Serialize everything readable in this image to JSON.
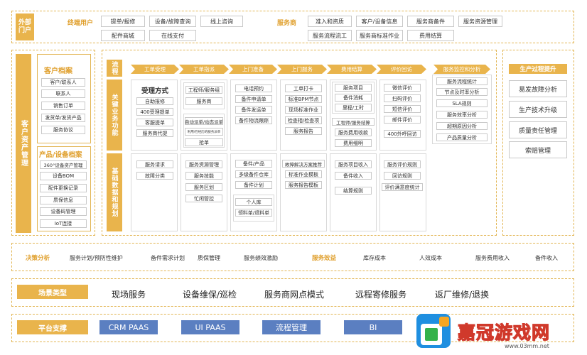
{
  "top": {
    "portal_label": "外部门户",
    "terminal_user": "终端用户",
    "terminal_items": [
      "提单/报修",
      "设备/故障查询",
      "线上咨询",
      "配件商城",
      "在线支付"
    ],
    "provider": "服务商",
    "provider_items": [
      "准入和资质",
      "客户/设备信息",
      "服务商备件",
      "服务资源管理",
      "服务流程流工",
      "服务商标准作业",
      "费用结算"
    ]
  },
  "left": {
    "side_label": "客户资产管理",
    "customer_title": "客户档案",
    "customer_items": [
      "客户/联系人",
      "联系人",
      "销售订单",
      "发货单/发货产品",
      "服务协议"
    ],
    "device_title": "产品/设备档案",
    "device_items": [
      "360°设备资产管理",
      "设备BOM",
      "配件更换记录",
      "质保信息",
      "设备码管理",
      "IoT连接"
    ]
  },
  "mid": {
    "flow_label": "流程",
    "key_label": "关键业务功能",
    "base_label": "基础数据和规划",
    "stages": [
      "工单受理",
      "工单指派",
      "上门准备",
      "上门服务",
      "费用结算",
      "评价回访",
      "服务监控和分析"
    ],
    "col1": {
      "title": "受理方式",
      "items": [
        "自助报修",
        "400受理提单",
        "客服提单",
        "服务商代提"
      ],
      "base": [
        "服务请求",
        "故障分类"
      ]
    },
    "col2": {
      "items_a": [
        "工程师/服务组",
        "服务商"
      ],
      "items_b": [
        "自动派单/动态派单",
        "利用/在经历的服务派单",
        "抢单"
      ],
      "base": [
        "服务资源管理",
        "服务技能",
        "服务区划",
        "忙闲管控"
      ]
    },
    "col3": {
      "items": [
        "电话预约",
        "备件申请单",
        "备件发运单",
        "备件物流跟踪"
      ],
      "base_a": [
        "备件/产品",
        "多级备件仓库",
        "备件计划"
      ],
      "base_b": [
        "个人库",
        "领料单/退料单"
      ]
    },
    "col4": {
      "items": [
        "工单打卡",
        "标准BPM节点",
        "现场标准作业",
        "检查相/检查项",
        "服务报告"
      ],
      "base": [
        "故障解决方案推荐",
        "标准作业模板",
        "服务报告模板"
      ]
    },
    "col5": {
      "items_a": [
        "服务项目",
        "备件消耗",
        "里程/工时"
      ],
      "items_b": [
        "工程师/服务结算",
        "服务费用收款",
        "费用细明"
      ],
      "base": [
        "服务项目收入",
        "备件收入",
        "结算规则"
      ]
    },
    "col6": {
      "items": [
        "微信评价",
        "扫码评价",
        "短信评价",
        "邮件评价",
        "400外呼回访"
      ],
      "base": [
        "服务评价规则",
        "回访规则",
        "评价满意度统计"
      ]
    },
    "col7": {
      "items": [
        "服务流程统计",
        "节点及时率分析",
        "SLA规则",
        "服务效率分析",
        "超期原因分析",
        "产品质量分析"
      ]
    }
  },
  "right": {
    "title": "生产过程提升",
    "items": [
      "易发故障分析",
      "生产技术升级",
      "质量责任管理",
      "索赔管理"
    ]
  },
  "decision": {
    "label": "决策分析",
    "items_a": [
      "服务计划/预防性维护",
      "备件需求计划",
      "质保管理",
      "服务绩效激励"
    ],
    "benefit": "服务效益",
    "items_b": [
      "库存成本",
      "人效成本",
      "服务费用收入",
      "备件收入"
    ]
  },
  "scene": {
    "label": "场景类型",
    "items": [
      "现场服务",
      "设备维保/巡检",
      "服务商网点模式",
      "远程寄修服务",
      "返厂维修/退换"
    ]
  },
  "platform": {
    "label": "平台支撑",
    "items": [
      "CRM PAAS",
      "UI PAAS",
      "流程管理",
      "BI"
    ]
  },
  "watermark": {
    "brand": "嘉冠游戏网",
    "url": "www.03mm.net"
  }
}
